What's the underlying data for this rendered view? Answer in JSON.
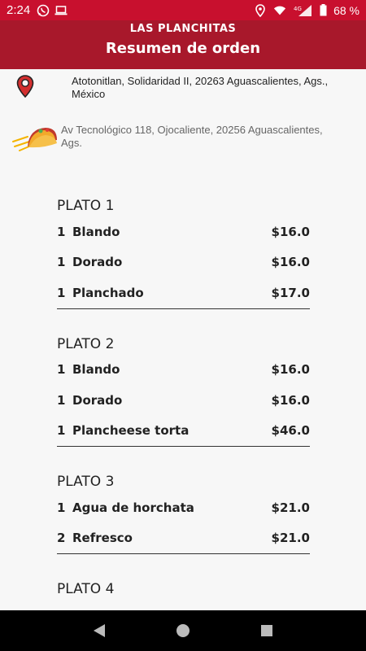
{
  "status_bar": {
    "time": "2:24",
    "battery": "68 %",
    "network": "4G"
  },
  "header": {
    "brand": "LAS PLANCHITAS",
    "title": "Resumen de orden"
  },
  "addresses": {
    "delivery": "Atotonitlan, Solidaridad II, 20263 Aguascalientes, Ags., México",
    "restaurant": "Av Tecnológico 118, Ojocaliente, 20256 Aguascalientes, Ags."
  },
  "plates": [
    {
      "title": "PLATO 1",
      "items": [
        {
          "qty": "1",
          "name": "Blando",
          "price": "$16.0"
        },
        {
          "qty": "1",
          "name": "Dorado",
          "price": "$16.0"
        },
        {
          "qty": "1",
          "name": "Planchado",
          "price": "$17.0"
        }
      ]
    },
    {
      "title": "PLATO 2",
      "items": [
        {
          "qty": "1",
          "name": "Blando",
          "price": "$16.0"
        },
        {
          "qty": "1",
          "name": "Dorado",
          "price": "$16.0"
        },
        {
          "qty": "1",
          "name": "Plancheese torta",
          "price": "$46.0"
        }
      ]
    },
    {
      "title": "PLATO 3",
      "items": [
        {
          "qty": "1",
          "name": "Agua de horchata",
          "price": "$21.0"
        },
        {
          "qty": "2",
          "name": "Refresco",
          "price": "$21.0"
        }
      ]
    },
    {
      "title": "PLATO 4",
      "items": []
    }
  ],
  "colors": {
    "status_bar": "#c8102e",
    "header": "#a8182b",
    "background": "#f7f7f7"
  }
}
